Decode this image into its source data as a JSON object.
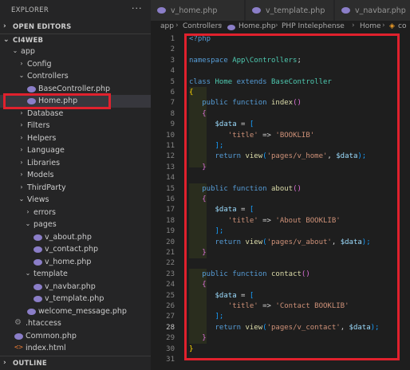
{
  "sidebar": {
    "title": "EXPLORER",
    "more_icon": "ellipsis-icon",
    "sections": {
      "open_editors": "OPEN EDITORS",
      "workspace": "CI4WEB",
      "outline": "OUTLINE"
    },
    "tree": [
      {
        "label": "app",
        "type": "folder",
        "open": true,
        "level": 1
      },
      {
        "label": "Config",
        "type": "folder",
        "open": false,
        "level": 2
      },
      {
        "label": "Controllers",
        "type": "folder",
        "open": true,
        "level": 2
      },
      {
        "label": "BaseController.php",
        "type": "php",
        "level": 3
      },
      {
        "label": "Home.php",
        "type": "php",
        "level": 3,
        "selected": true
      },
      {
        "label": "Database",
        "type": "folder",
        "open": false,
        "level": 2
      },
      {
        "label": "Filters",
        "type": "folder",
        "open": false,
        "level": 2
      },
      {
        "label": "Helpers",
        "type": "folder",
        "open": false,
        "level": 2
      },
      {
        "label": "Language",
        "type": "folder",
        "open": false,
        "level": 2
      },
      {
        "label": "Libraries",
        "type": "folder",
        "open": false,
        "level": 2
      },
      {
        "label": "Models",
        "type": "folder",
        "open": false,
        "level": 2
      },
      {
        "label": "ThirdParty",
        "type": "folder",
        "open": false,
        "level": 2
      },
      {
        "label": "Views",
        "type": "folder",
        "open": true,
        "level": 2
      },
      {
        "label": "errors",
        "type": "folder",
        "open": false,
        "level": 3
      },
      {
        "label": "pages",
        "type": "folder",
        "open": true,
        "level": 3
      },
      {
        "label": "v_about.php",
        "type": "php",
        "level": 4
      },
      {
        "label": "v_contact.php",
        "type": "php",
        "level": 4
      },
      {
        "label": "v_home.php",
        "type": "php",
        "level": 4
      },
      {
        "label": "template",
        "type": "folder",
        "open": true,
        "level": 3
      },
      {
        "label": "v_navbar.php",
        "type": "php",
        "level": 4
      },
      {
        "label": "v_template.php",
        "type": "php",
        "level": 4
      },
      {
        "label": "welcome_message.php",
        "type": "php",
        "level": 3
      },
      {
        "label": ".htaccess",
        "type": "gear",
        "level": 1
      },
      {
        "label": "Common.php",
        "type": "php",
        "level": 1
      },
      {
        "label": "index.html",
        "type": "html",
        "level": 1
      }
    ]
  },
  "tabs": [
    {
      "label": "v_home.php"
    },
    {
      "label": "v_template.php"
    },
    {
      "label": "v_navbar.php"
    }
  ],
  "breadcrumb": {
    "items": [
      "app",
      "Controllers",
      "Home.php",
      "PHP Intelephense",
      "Home",
      "co"
    ]
  },
  "editor": {
    "active_line": "28",
    "line_numbers": [
      "1",
      "2",
      "3",
      "4",
      "5",
      "6",
      "7",
      "8",
      "9",
      "10",
      "11",
      "12",
      "13",
      "14",
      "15",
      "16",
      "17",
      "18",
      "19",
      "20",
      "21",
      "22",
      "23",
      "24",
      "25",
      "26",
      "27",
      "28",
      "29",
      "30",
      "31"
    ],
    "tokens": {
      "open_tag": "<?php",
      "namespace_kw": "namespace",
      "namespace_name": "App\\Controllers",
      "semi": ";",
      "class_kw": "class",
      "class_name": "Home",
      "extends_kw": "extends",
      "base_class": "BaseController",
      "brace_open": "{",
      "brace_close": "}",
      "public_kw": "public",
      "function_kw": "function",
      "fn_index": "index",
      "fn_about": "about",
      "fn_contact": "contact",
      "parens": "()",
      "data_var": "$data",
      "assign": " = ",
      "bracket_open": "[",
      "bracket_close": "];",
      "title_key": "'title'",
      "arrow": " => ",
      "title_home": "'BOOKLIB'",
      "title_about": "'About BOOKLIB'",
      "title_contact": "'Contact BOOKLIB'",
      "return_kw": "return",
      "view_fn": "view",
      "paren_open": "(",
      "paren_close": ");",
      "view_home": "'pages/v_home'",
      "view_about": "'pages/v_about'",
      "view_contact": "'pages/v_contact'",
      "comma": ", "
    }
  },
  "colors": {
    "highlight_border": "#e0212d",
    "background": "#1e1e1e",
    "sidebar": "#252526",
    "php_icon": "#8b7ec8"
  }
}
